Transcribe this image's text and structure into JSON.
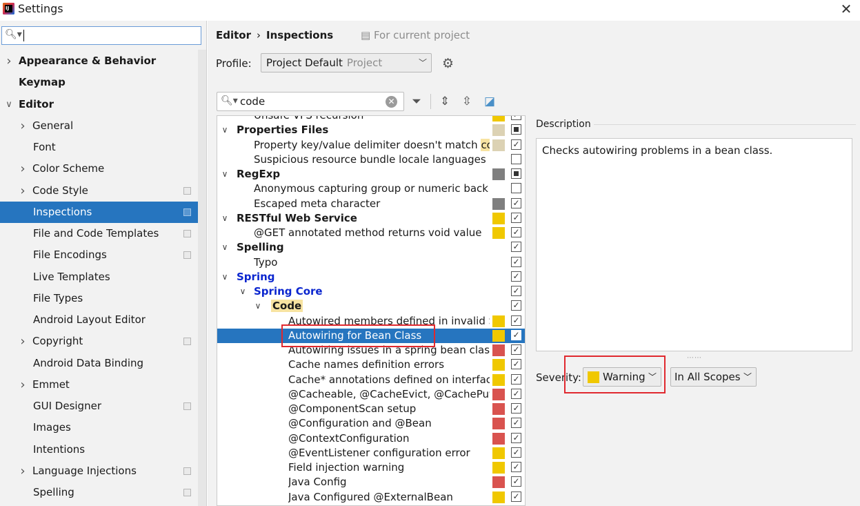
{
  "window": {
    "title": "Settings",
    "app_icon_text": "IJ"
  },
  "sidebar": {
    "search_value": "",
    "items": [
      {
        "label": "Appearance & Behavior",
        "bold": true,
        "chevron": "right",
        "indent": 0
      },
      {
        "label": "Keymap",
        "bold": true,
        "chevron": "",
        "indent": 0
      },
      {
        "label": "Editor",
        "bold": true,
        "chevron": "down",
        "indent": 0
      },
      {
        "label": "General",
        "chevron": "right",
        "indent": 1
      },
      {
        "label": "Font",
        "chevron": "",
        "indent": 1
      },
      {
        "label": "Color Scheme",
        "chevron": "right",
        "indent": 1
      },
      {
        "label": "Code Style",
        "chevron": "right",
        "indent": 1,
        "project": true
      },
      {
        "label": "Inspections",
        "chevron": "",
        "indent": 1,
        "project": true,
        "selected": true
      },
      {
        "label": "File and Code Templates",
        "chevron": "",
        "indent": 1,
        "project": true
      },
      {
        "label": "File Encodings",
        "chevron": "",
        "indent": 1,
        "project": true
      },
      {
        "label": "Live Templates",
        "chevron": "",
        "indent": 1
      },
      {
        "label": "File Types",
        "chevron": "",
        "indent": 1
      },
      {
        "label": "Android Layout Editor",
        "chevron": "",
        "indent": 1
      },
      {
        "label": "Copyright",
        "chevron": "right",
        "indent": 1,
        "project": true
      },
      {
        "label": "Android Data Binding",
        "chevron": "",
        "indent": 1
      },
      {
        "label": "Emmet",
        "chevron": "right",
        "indent": 1
      },
      {
        "label": "GUI Designer",
        "chevron": "",
        "indent": 1,
        "project": true
      },
      {
        "label": "Images",
        "chevron": "",
        "indent": 1
      },
      {
        "label": "Intentions",
        "chevron": "",
        "indent": 1
      },
      {
        "label": "Language Injections",
        "chevron": "right",
        "indent": 1,
        "project": true
      },
      {
        "label": "Spelling",
        "chevron": "",
        "indent": 1,
        "project": true
      }
    ]
  },
  "header": {
    "crumb_parent": "Editor",
    "crumb_separator": "›",
    "crumb_current": "Inspections",
    "for_project": "For current project"
  },
  "profile": {
    "label": "Profile:",
    "value": "Project Default",
    "sub": "Project"
  },
  "filter": {
    "value": "code"
  },
  "colors": {
    "warning": "#f0c800",
    "weak_warning": "#dcd2b4",
    "error": "#d9534f",
    "server_problem": "#7f7f7f",
    "selection": "#2675bf",
    "annotation": "#e0282e"
  },
  "tree": {
    "rows": [
      {
        "label": "Unsafe VFS recursion",
        "level": 1,
        "type": "item",
        "sev": "warning",
        "check": "checked",
        "partial": true
      },
      {
        "label": "Properties Files",
        "level": 0,
        "type": "cat",
        "sev": "weak_warning",
        "check": "mixed",
        "expanded": true
      },
      {
        "label": "Property key/value delimiter doesn't match ",
        "match": "cod",
        "level": 1,
        "type": "item",
        "sev": "weak_warning",
        "check": "checked"
      },
      {
        "label": "Suspicious resource bundle locale languages",
        "level": 1,
        "type": "item",
        "sev": "",
        "check": "unchecked"
      },
      {
        "label": "RegExp",
        "level": 0,
        "type": "cat",
        "sev": "server_problem",
        "check": "mixed",
        "expanded": true
      },
      {
        "label": "Anonymous capturing group or numeric back r",
        "level": 1,
        "type": "item",
        "sev": "",
        "check": "unchecked"
      },
      {
        "label": "Escaped meta character",
        "level": 1,
        "type": "item",
        "sev": "server_problem",
        "check": "checked"
      },
      {
        "label": "RESTful Web Service",
        "level": 0,
        "type": "cat",
        "sev": "warning",
        "check": "checked",
        "expanded": true
      },
      {
        "label": "@GET annotated method returns void value",
        "level": 1,
        "type": "item",
        "sev": "warning",
        "check": "checked"
      },
      {
        "label": "Spelling",
        "level": 0,
        "type": "cat",
        "sev": "",
        "check": "checked",
        "expanded": true
      },
      {
        "label": "Typo",
        "level": 1,
        "type": "item",
        "sev": "",
        "check": "checked"
      },
      {
        "label": "Spring",
        "level": 0,
        "type": "cat",
        "blue": true,
        "sev": "",
        "check": "checked",
        "expanded": true
      },
      {
        "label": "Spring Core",
        "level": 1,
        "type": "cat",
        "blue": true,
        "sev": "",
        "check": "checked",
        "expanded": true
      },
      {
        "label": "Code",
        "level": 2,
        "type": "cat",
        "highlight": true,
        "sev": "",
        "check": "checked",
        "expanded": true
      },
      {
        "label": "Autowired members defined in invalid S",
        "level": 3,
        "type": "item",
        "sev": "warning",
        "check": "checked"
      },
      {
        "label": "Autowiring for Bean Class",
        "level": 3,
        "type": "item",
        "sev": "warning",
        "check": "checked",
        "selected": true
      },
      {
        "label": "Autowiring issues in a spring bean class (",
        "level": 3,
        "type": "item",
        "sev": "error",
        "check": "checked"
      },
      {
        "label": "Cache names definition errors",
        "level": 3,
        "type": "item",
        "sev": "warning",
        "check": "checked"
      },
      {
        "label": "Cache* annotations defined on interface",
        "level": 3,
        "type": "item",
        "sev": "warning",
        "check": "checked"
      },
      {
        "label": "@Cacheable, @CacheEvict, @CachePut, (",
        "level": 3,
        "type": "item",
        "sev": "error",
        "check": "checked"
      },
      {
        "label": "@ComponentScan setup",
        "level": 3,
        "type": "item",
        "sev": "error",
        "check": "checked"
      },
      {
        "label": "@Configuration and @Bean",
        "level": 3,
        "type": "item",
        "sev": "error",
        "check": "checked"
      },
      {
        "label": "@ContextConfiguration",
        "level": 3,
        "type": "item",
        "sev": "error",
        "check": "checked"
      },
      {
        "label": "@EventListener configuration error",
        "level": 3,
        "type": "item",
        "sev": "warning",
        "check": "checked"
      },
      {
        "label": "Field injection warning",
        "level": 3,
        "type": "item",
        "sev": "warning",
        "check": "checked"
      },
      {
        "label": "Java Config",
        "level": 3,
        "type": "item",
        "sev": "error",
        "check": "checked"
      },
      {
        "label": "Java Configured @ExternalBean",
        "level": 3,
        "type": "item",
        "sev": "warning",
        "check": "checked"
      }
    ]
  },
  "description": {
    "label": "Description",
    "text": "Checks autowiring problems in a bean class."
  },
  "severity": {
    "label": "Severity:",
    "value": "Warning"
  },
  "scope": {
    "value": "In All Scopes"
  }
}
